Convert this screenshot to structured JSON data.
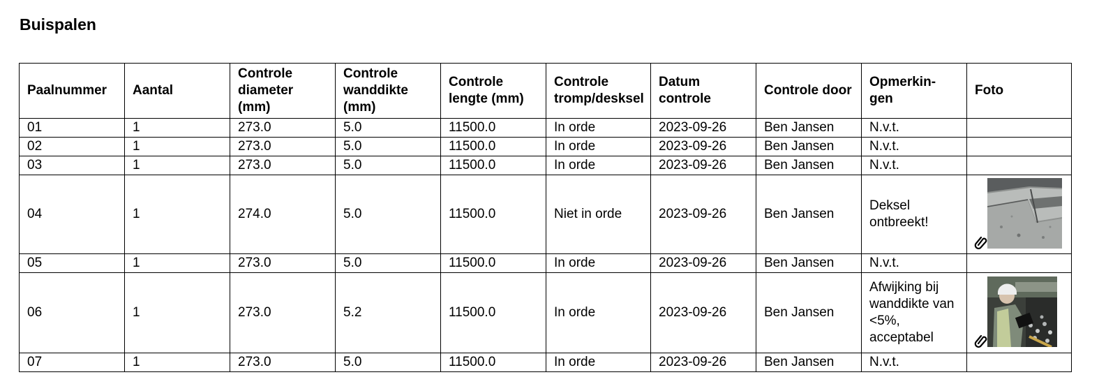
{
  "title": "Buispalen",
  "table": {
    "headers": [
      "Paalnummer",
      "Aantal",
      "Controle diameter (mm)",
      "Controle wanddikte (mm)",
      "Controle lengte (mm)",
      "Controle tromp/desksel",
      "Datum controle",
      "Controle door",
      "Opmerkin-gen",
      "Foto"
    ],
    "rows": [
      {
        "paalnummer": "01",
        "aantal": "1",
        "diameter": "273.0",
        "wanddikte": "5.0",
        "lengte": "11500.0",
        "tromp": "In orde",
        "datum": "2023-09-26",
        "door": "Ben Jansen",
        "opmerkingen": "N.v.t.",
        "foto": ""
      },
      {
        "paalnummer": "02",
        "aantal": "1",
        "diameter": "273.0",
        "wanddikte": "5.0",
        "lengte": "11500.0",
        "tromp": "In orde",
        "datum": "2023-09-26",
        "door": "Ben Jansen",
        "opmerkingen": "N.v.t.",
        "foto": ""
      },
      {
        "paalnummer": "03",
        "aantal": "1",
        "diameter": "273.0",
        "wanddikte": "5.0",
        "lengte": "11500.0",
        "tromp": "In orde",
        "datum": "2023-09-26",
        "door": "Ben Jansen",
        "opmerkingen": "N.v.t.",
        "foto": ""
      },
      {
        "paalnummer": "04",
        "aantal": "1",
        "diameter": "274.0",
        "wanddikte": "5.0",
        "lengte": "11500.0",
        "tromp": "Niet in orde",
        "datum": "2023-09-26",
        "door": "Ben Jansen",
        "opmerkingen": "Deksel ontbreekt!",
        "foto": "concrete-photo"
      },
      {
        "paalnummer": "05",
        "aantal": "1",
        "diameter": "273.0",
        "wanddikte": "5.0",
        "lengte": "11500.0",
        "tromp": "In orde",
        "datum": "2023-09-26",
        "door": "Ben Jansen",
        "opmerkingen": "N.v.t.",
        "foto": ""
      },
      {
        "paalnummer": "06",
        "aantal": "1",
        "diameter": "273.0",
        "wanddikte": "5.2",
        "lengte": "11500.0",
        "tromp": "In orde",
        "datum": "2023-09-26",
        "door": "Ben Jansen",
        "opmerkingen": "Afwijking bij wanddikte van <5%, acceptabel",
        "foto": "worker-photo"
      },
      {
        "paalnummer": "07",
        "aantal": "1",
        "diameter": "273.0",
        "wanddikte": "5.0",
        "lengte": "11500.0",
        "tromp": "In orde",
        "datum": "2023-09-26",
        "door": "Ben Jansen",
        "opmerkingen": "N.v.t.",
        "foto": ""
      }
    ]
  },
  "icons": {
    "attachment": "paperclip-icon"
  }
}
